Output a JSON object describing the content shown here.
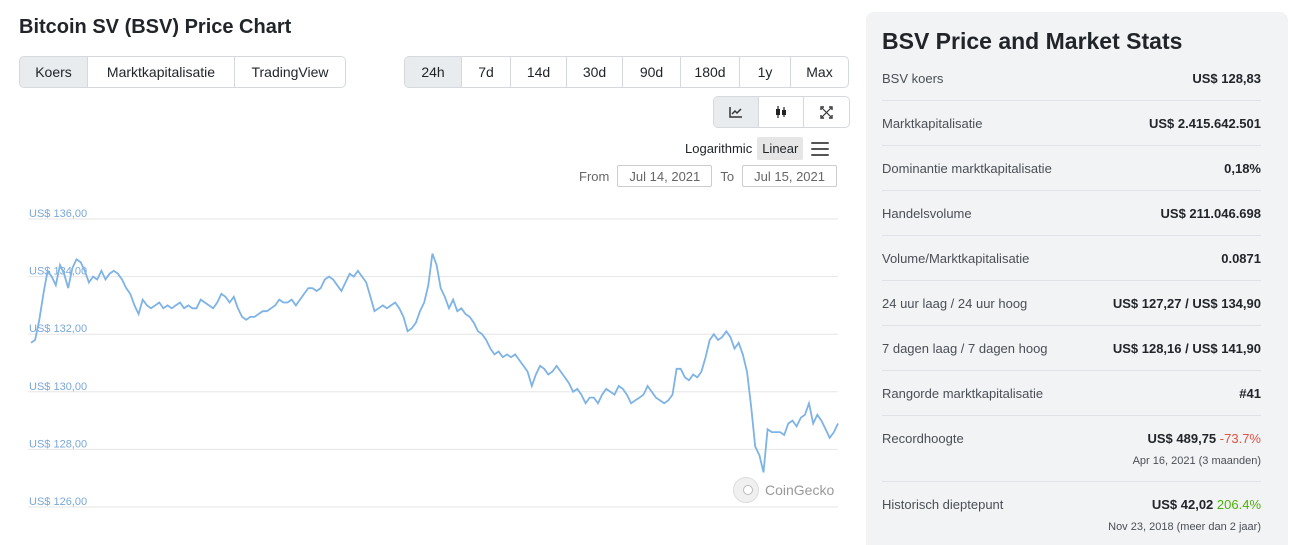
{
  "page": {
    "title": "Bitcoin SV (BSV) Price Chart"
  },
  "view_tabs": [
    {
      "label": "Koers",
      "active": true
    },
    {
      "label": "Marktkapitalisatie",
      "active": false
    },
    {
      "label": "TradingView",
      "active": false
    }
  ],
  "range_tabs": [
    {
      "label": "24h",
      "active": true
    },
    {
      "label": "7d",
      "active": false
    },
    {
      "label": "14d",
      "active": false
    },
    {
      "label": "30d",
      "active": false
    },
    {
      "label": "90d",
      "active": false
    },
    {
      "label": "180d",
      "active": false
    },
    {
      "label": "1y",
      "active": false
    },
    {
      "label": "Max",
      "active": false
    }
  ],
  "tools": {
    "line_icon": "line-chart-icon",
    "candle_icon": "candlestick-icon",
    "expand_icon": "expand-icon"
  },
  "scale": {
    "logarithmic": "Logarithmic",
    "linear": "Linear",
    "active": "linear"
  },
  "dates": {
    "from_label": "From",
    "from_value": "Jul 14, 2021",
    "to_label": "To",
    "to_value": "Jul 15, 2021"
  },
  "watermark": "CoinGecko",
  "chart_data": {
    "type": "line",
    "y_ticks": [
      "US$ 136,00",
      "US$ 134,00",
      "US$ 132,00",
      "US$ 130,00",
      "US$ 128,00",
      "US$ 126,00"
    ],
    "ylim": [
      126,
      136
    ],
    "grid": true,
    "line_color": "#7db3e5",
    "series": [
      {
        "values": [
          131.7,
          131.8,
          132.5,
          133.4,
          134.2,
          134.0,
          133.7,
          134.4,
          134.1,
          133.6,
          134.3,
          134.6,
          134.5,
          134.2,
          133.8,
          134.0,
          133.9,
          134.2,
          133.9,
          134.1,
          134.2,
          134.1,
          133.9,
          133.6,
          133.4,
          133.0,
          132.7,
          133.2,
          133.0,
          132.9,
          133.0,
          133.1,
          132.9,
          133.0,
          132.9,
          133.0,
          133.1,
          132.9,
          133.0,
          132.9,
          132.9,
          133.2,
          133.1,
          133.0,
          132.9,
          133.1,
          133.4,
          133.3,
          133.1,
          133.3,
          132.9,
          132.6,
          132.5,
          132.6,
          132.6,
          132.7,
          132.8,
          132.8,
          132.9,
          133.0,
          133.2,
          133.1,
          133.1,
          133.2,
          133.0,
          133.2,
          133.4,
          133.6,
          133.6,
          133.5,
          133.6,
          133.9,
          134.0,
          133.9,
          133.7,
          133.5,
          133.8,
          134.1,
          134.0,
          134.2,
          134.0,
          133.8,
          133.3,
          132.8,
          132.9,
          133.0,
          132.9,
          133.0,
          133.1,
          132.9,
          132.6,
          132.1,
          132.2,
          132.4,
          132.8,
          133.1,
          133.7,
          134.8,
          134.4,
          133.6,
          133.3,
          132.9,
          133.2,
          132.8,
          132.9,
          132.7,
          132.6,
          132.4,
          132.1,
          132.0,
          131.8,
          131.5,
          131.3,
          131.4,
          131.2,
          131.3,
          131.2,
          131.3,
          131.1,
          130.9,
          130.7,
          130.2,
          130.6,
          130.9,
          130.8,
          130.6,
          130.7,
          130.9,
          130.7,
          130.5,
          130.3,
          130.0,
          130.1,
          129.9,
          129.6,
          129.8,
          129.8,
          129.6,
          129.9,
          130.1,
          130.0,
          129.9,
          130.2,
          130.1,
          129.9,
          129.6,
          129.7,
          129.8,
          129.9,
          130.2,
          130.0,
          129.8,
          129.7,
          129.6,
          129.7,
          129.9,
          130.8,
          130.8,
          130.5,
          130.4,
          130.6,
          130.5,
          130.7,
          131.2,
          131.8,
          132.0,
          131.8,
          131.9,
          132.1,
          131.9,
          131.5,
          131.7,
          131.3,
          130.7,
          129.5,
          128.1,
          127.8,
          127.2,
          128.7,
          128.6,
          128.6,
          128.6,
          128.5,
          128.9,
          129.0,
          128.8,
          129.1,
          129.2,
          129.6,
          128.9,
          129.2,
          129.0,
          128.7,
          128.4,
          128.6,
          128.9
        ]
      }
    ]
  },
  "stats": {
    "title": "BSV Price and Market Stats",
    "rows": [
      {
        "label": "BSV koers",
        "value": "US$ 128,83"
      },
      {
        "label": "Marktkapitalisatie",
        "value": "US$ 2.415.642.501"
      },
      {
        "label": "Dominantie marktkapitalisatie",
        "value": "0,18%"
      },
      {
        "label": "Handelsvolume",
        "value": "US$ 211.046.698"
      },
      {
        "label": "Volume/Marktkapitalisatie",
        "value": "0.0871"
      },
      {
        "label": "24 uur laag / 24 uur hoog",
        "value": "US$ 127,27 / US$ 134,90"
      },
      {
        "label": "7 dagen laag / 7 dagen hoog",
        "value": "US$ 128,16 / US$ 141,90"
      },
      {
        "label": "Rangorde marktkapitalisatie",
        "value": "#41"
      }
    ],
    "ath": {
      "label": "Recordhoogte",
      "value": "US$ 489,75",
      "change": "-73.7%",
      "change_color": "#e15241",
      "date": "Apr 16, 2021 (3 maanden)"
    },
    "atl": {
      "label": "Historisch dieptepunt",
      "value": "US$ 42,02",
      "change": "206.4%",
      "change_color": "#4eaf0a",
      "date": "Nov 23, 2018 (meer dan 2 jaar)"
    }
  }
}
